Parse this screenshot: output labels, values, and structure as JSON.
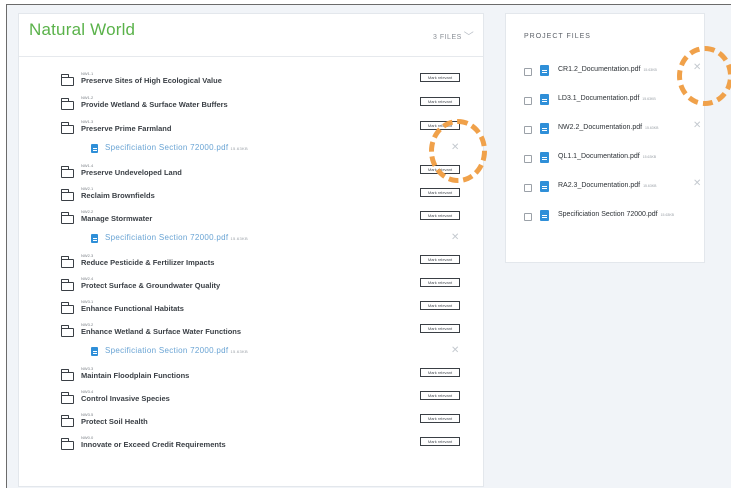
{
  "main": {
    "title": "Natural World",
    "file_count": "3 FILES",
    "mark_label": "Mark relevant",
    "credits": [
      {
        "code": "NW1.1",
        "name": "Preserve Sites of High Ecological Value"
      },
      {
        "code": "NW1.2",
        "name": "Provide Wetland & Surface Water Buffers"
      },
      {
        "code": "NW1.3",
        "name": "Preserve Prime Farmland",
        "attachment": {
          "name": "Specificiation Section 72000.pdf",
          "size": "15.63KB"
        }
      },
      {
        "code": "NW1.4",
        "name": "Preserve Undeveloped Land"
      },
      {
        "code": "NW2.1",
        "name": "Reclaim Brownfields"
      },
      {
        "code": "NW2.2",
        "name": "Manage Stormwater",
        "attachment": {
          "name": "Specificiation Section 72000.pdf",
          "size": "15.63KB"
        }
      },
      {
        "code": "NW2.3",
        "name": "Reduce Pesticide & Fertilizer Impacts"
      },
      {
        "code": "NW2.4",
        "name": "Protect Surface & Groundwater Quality"
      },
      {
        "code": "NW3.1",
        "name": "Enhance Functional Habitats"
      },
      {
        "code": "NW3.2",
        "name": "Enhance Wetland & Surface Water Functions",
        "attachment": {
          "name": "Specificiation Section 72000.pdf",
          "size": "15.63KB"
        }
      },
      {
        "code": "NW3.3",
        "name": "Maintain Floodplain Functions"
      },
      {
        "code": "NW3.4",
        "name": "Control Invasive Species"
      },
      {
        "code": "NW3.5",
        "name": "Protect Soil Health"
      },
      {
        "code": "NW0.0",
        "name": "Innovate or Exceed Credit Requirements"
      }
    ]
  },
  "project_files": {
    "title": "PROJECT FILES",
    "files": [
      {
        "name": "CR1.2_Documentation.pdf",
        "size": "15.63KB",
        "removable": true
      },
      {
        "name": "LD3.1_Documentation.pdf",
        "size": "15.63KB",
        "removable": false
      },
      {
        "name": "NW2.2_Documentation.pdf",
        "size": "15.63KB",
        "removable": true
      },
      {
        "name": "QL1.1_Documentation.pdf",
        "size": "15.63KB",
        "removable": false
      },
      {
        "name": "RA2.3_Documentation.pdf",
        "size": "15.63KB",
        "removable": true
      },
      {
        "name": "Specificiation Section 72000.pdf",
        "size": "15.63KB",
        "removable": false
      }
    ]
  },
  "icons": {
    "folder": "folder-icon",
    "document": "document-icon",
    "close": "close-icon",
    "chevron": "chevron-down-icon"
  },
  "colors": {
    "accent_green": "#5ab24a",
    "doc_blue": "#2f8fd8",
    "highlight_orange": "#f0a14a"
  }
}
